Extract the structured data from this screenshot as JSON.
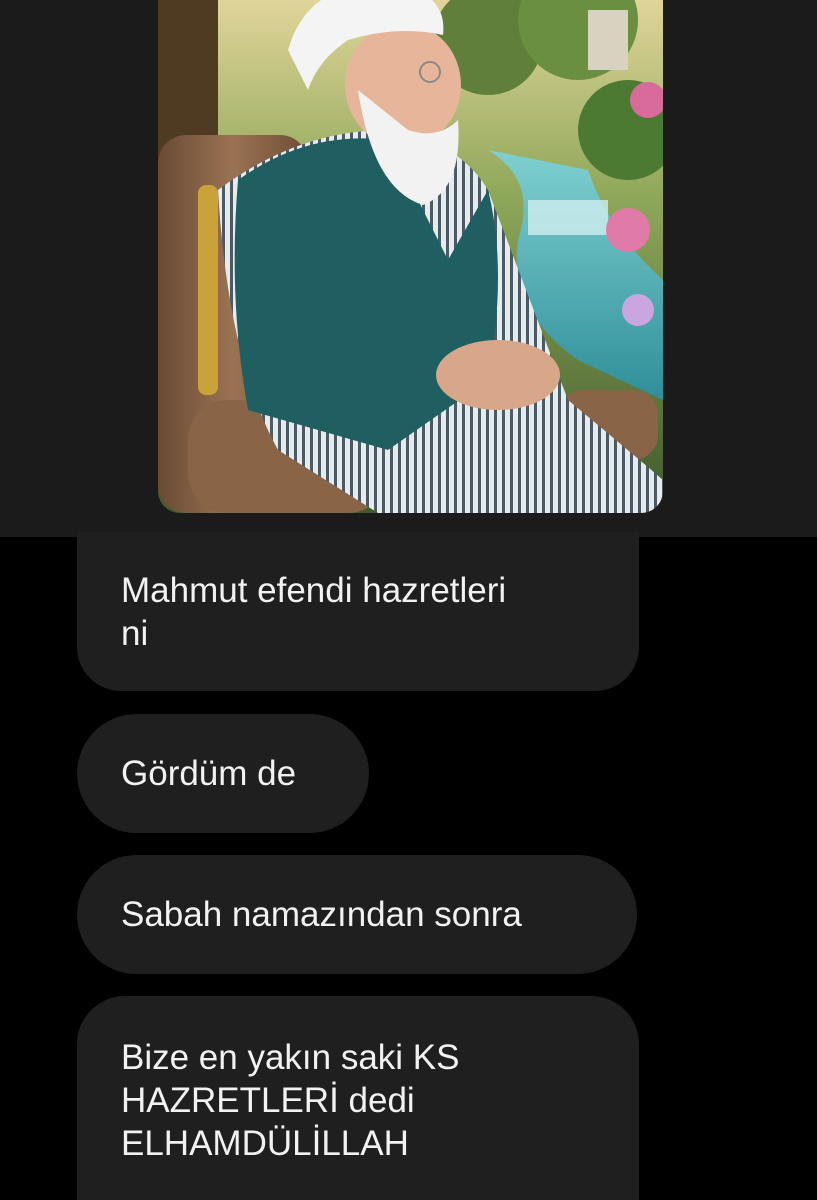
{
  "conversation": {
    "image_message": {
      "alt_subject": "photo"
    },
    "messages": [
      {
        "text": "Mahmut efendi hazretleri\nni"
      },
      {
        "text": "Gördüm de"
      },
      {
        "text": "Sabah namazından sonra"
      },
      {
        "text": "Bize en yakın saki KS\nHAZRETLERİ dedi\nELHAMDÜLİLLAH"
      }
    ]
  },
  "colors": {
    "background": "#000000",
    "top_band": "#1b1b1b",
    "bubble": "#1f1f1f",
    "text": "#f2f2f2"
  }
}
